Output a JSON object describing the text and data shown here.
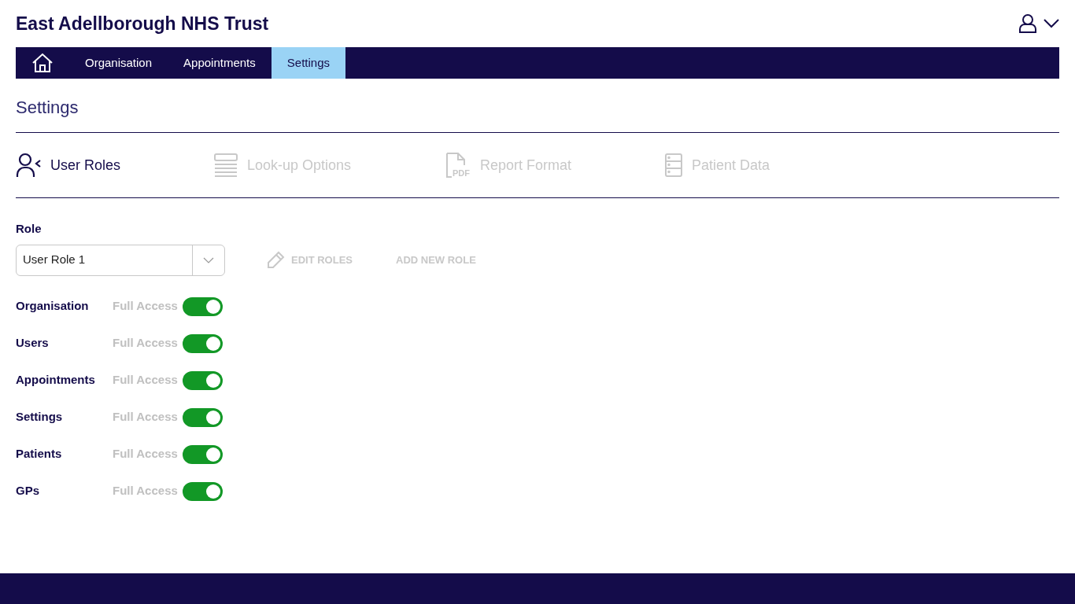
{
  "header": {
    "title": "East Adellborough NHS Trust"
  },
  "nav": {
    "tabs": [
      {
        "label": "Organisation",
        "selected": false
      },
      {
        "label": "Appointments",
        "selected": false
      },
      {
        "label": "Settings",
        "selected": true
      }
    ]
  },
  "page_title": "Settings",
  "section_tabs": [
    {
      "label": "User Roles",
      "selected": true
    },
    {
      "label": "Look-up Options",
      "selected": false
    },
    {
      "label": "Report Format",
      "selected": false,
      "icon_text": "PDF"
    },
    {
      "label": "Patient Data",
      "selected": false
    }
  ],
  "role": {
    "label": "Role",
    "value": "User Role 1"
  },
  "actions": [
    {
      "label": "EDIT ROLES",
      "disabled": true
    },
    {
      "label": "ADD NEW ROLE",
      "disabled": true
    }
  ],
  "permissions": [
    {
      "name": "Organisation",
      "access": "Full Access",
      "on": true
    },
    {
      "name": "Users",
      "access": "Full Access",
      "on": true
    },
    {
      "name": "Appointments",
      "access": "Full Access",
      "on": true
    },
    {
      "name": "Settings",
      "access": "Full Access",
      "on": true
    },
    {
      "name": "Patients",
      "access": "Full Access",
      "on": true
    },
    {
      "name": "GPs",
      "access": "Full Access",
      "on": true
    }
  ]
}
